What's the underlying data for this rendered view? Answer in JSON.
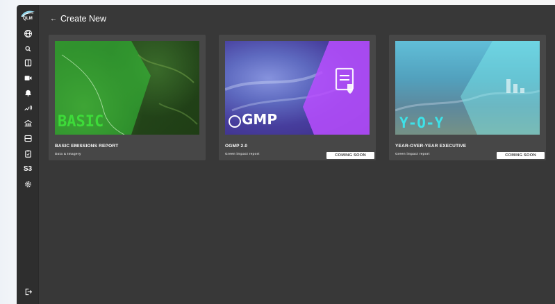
{
  "sidebar": {
    "logo_text": "QLM",
    "items": [
      {
        "name": "globe-icon"
      },
      {
        "name": "search-icon"
      },
      {
        "name": "panel-icon"
      },
      {
        "name": "video-icon"
      },
      {
        "name": "bell-icon"
      },
      {
        "name": "signal-icon"
      },
      {
        "name": "building-icon"
      },
      {
        "name": "layout-icon"
      },
      {
        "name": "clipboard-icon"
      },
      {
        "name": "s3-label",
        "label": "S3"
      },
      {
        "name": "gear-icon"
      }
    ],
    "logout_icon": "logout-icon"
  },
  "header": {
    "back_arrow": "←",
    "title": "Create New"
  },
  "cards": [
    {
      "title": "BASIC EMISSIONS REPORT",
      "subtitle": "Data & Imagery",
      "thumb_word": "BASIC",
      "badge": null
    },
    {
      "title": "OGMP 2.0",
      "subtitle": "Green impact report",
      "thumb_word": "GMP",
      "badge": "COMING SOON"
    },
    {
      "title": "YEAR-OVER-YEAR EXECUTIVE",
      "subtitle": "Green impact report",
      "thumb_word": "Y-O-Y",
      "badge": "COMING SOON"
    }
  ],
  "colors": {
    "app_bg": "#383838",
    "sidebar_bg": "#2e2e2e",
    "card_bg": "#474747",
    "basic_accent": "#3ee23a",
    "ogmp_accent": "#b84dff",
    "yoy_accent": "#39d6d6"
  }
}
